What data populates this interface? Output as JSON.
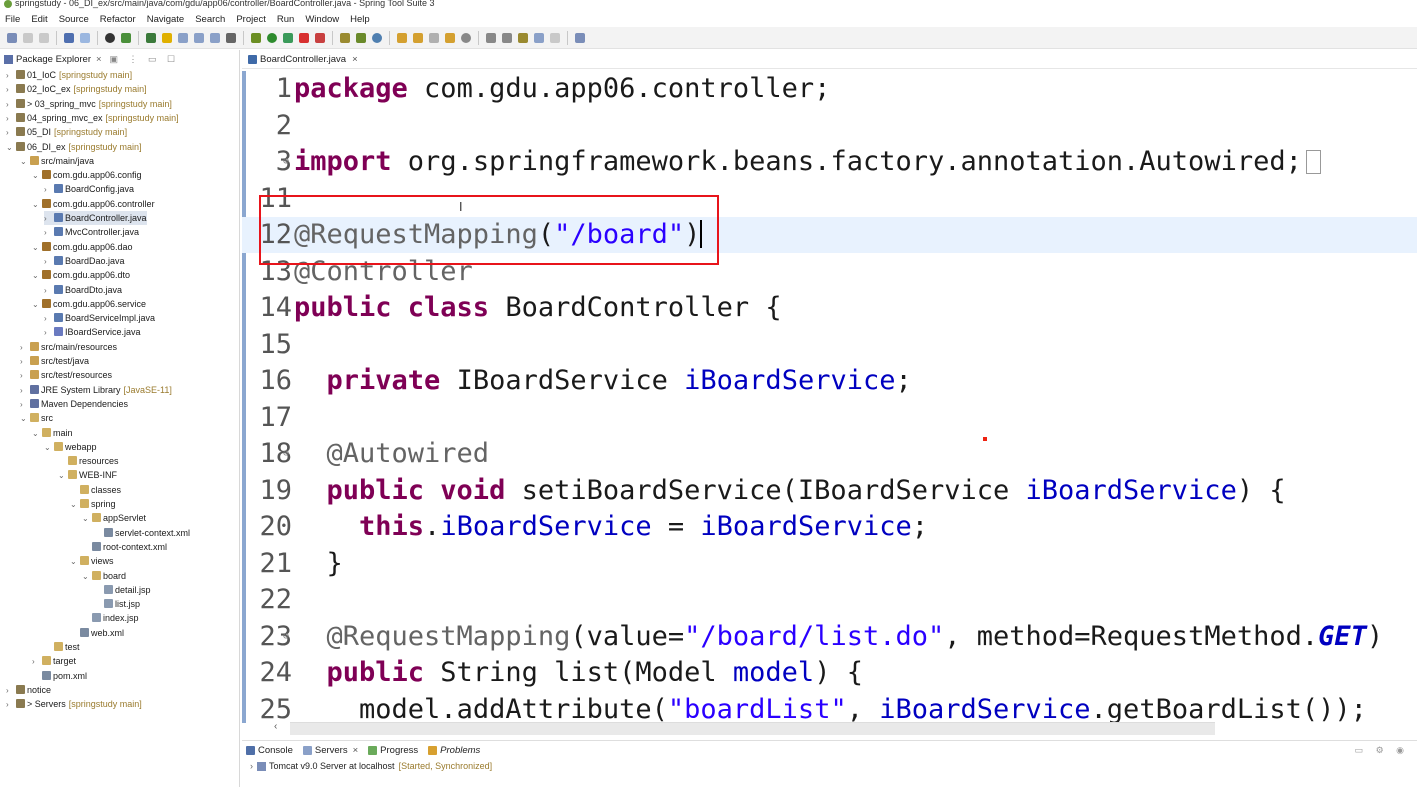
{
  "window": {
    "title": "springstudy - 06_DI_ex/src/main/java/com/gdu/app06/controller/BoardController.java - Spring Tool Suite 3"
  },
  "menu": [
    "File",
    "Edit",
    "Source",
    "Refactor",
    "Navigate",
    "Search",
    "Project",
    "Run",
    "Window",
    "Help"
  ],
  "explorer": {
    "tab_label": "Package Explorer",
    "items": [
      {
        "label": "01_IoC",
        "deco": "[springstudy main]"
      },
      {
        "label": "02_IoC_ex",
        "deco": "[springstudy main]"
      },
      {
        "label": "> 03_spring_mvc",
        "deco": "[springstudy main]"
      },
      {
        "label": "04_spring_mvc_ex",
        "deco": "[springstudy main]"
      },
      {
        "label": "05_DI",
        "deco": "[springstudy main]"
      },
      {
        "label": "06_DI_ex",
        "deco": "[springstudy main]"
      },
      {
        "label": "src/main/java",
        "deco": ""
      },
      {
        "label": "com.gdu.app06.config",
        "deco": ""
      },
      {
        "label": "BoardConfig.java",
        "deco": ""
      },
      {
        "label": "com.gdu.app06.controller",
        "deco": ""
      },
      {
        "label": "BoardController.java",
        "deco": ""
      },
      {
        "label": "MvcController.java",
        "deco": ""
      },
      {
        "label": "com.gdu.app06.dao",
        "deco": ""
      },
      {
        "label": "BoardDao.java",
        "deco": ""
      },
      {
        "label": "com.gdu.app06.dto",
        "deco": ""
      },
      {
        "label": "BoardDto.java",
        "deco": ""
      },
      {
        "label": "com.gdu.app06.service",
        "deco": ""
      },
      {
        "label": "BoardServiceImpl.java",
        "deco": ""
      },
      {
        "label": "IBoardService.java",
        "deco": ""
      },
      {
        "label": "src/main/resources",
        "deco": ""
      },
      {
        "label": "src/test/java",
        "deco": ""
      },
      {
        "label": "src/test/resources",
        "deco": ""
      },
      {
        "label": "JRE System Library",
        "deco": "[JavaSE-11]"
      },
      {
        "label": "Maven Dependencies",
        "deco": ""
      },
      {
        "label": "src",
        "deco": ""
      },
      {
        "label": "main",
        "deco": ""
      },
      {
        "label": "webapp",
        "deco": ""
      },
      {
        "label": "resources",
        "deco": ""
      },
      {
        "label": "WEB-INF",
        "deco": ""
      },
      {
        "label": "classes",
        "deco": ""
      },
      {
        "label": "spring",
        "deco": ""
      },
      {
        "label": "appServlet",
        "deco": ""
      },
      {
        "label": "servlet-context.xml",
        "deco": ""
      },
      {
        "label": "root-context.xml",
        "deco": ""
      },
      {
        "label": "views",
        "deco": ""
      },
      {
        "label": "board",
        "deco": ""
      },
      {
        "label": "detail.jsp",
        "deco": ""
      },
      {
        "label": "list.jsp",
        "deco": ""
      },
      {
        "label": "index.jsp",
        "deco": ""
      },
      {
        "label": "web.xml",
        "deco": ""
      },
      {
        "label": "test",
        "deco": ""
      },
      {
        "label": "target",
        "deco": ""
      },
      {
        "label": "pom.xml",
        "deco": ""
      },
      {
        "label": "notice",
        "deco": ""
      },
      {
        "label": "> Servers",
        "deco": "[springstudy main]"
      }
    ]
  },
  "editor": {
    "tab_label": "BoardController.java",
    "lines": [
      {
        "n": "1",
        "t1": "package com.gdu.app06.controller;"
      },
      {
        "n": "2"
      },
      {
        "n": "3",
        "t1": "import",
        "t2": " org.springframework.beans.factory.annotation.Autowired;"
      },
      {
        "n": "11"
      },
      {
        "n": "12",
        "t1": "@RequestMapping",
        "t2": "(",
        "t3": "\"/board\"",
        "t4": ")"
      },
      {
        "n": "13",
        "t1": "@Controller"
      },
      {
        "n": "14",
        "t1": "public class",
        "t2": " BoardController {"
      },
      {
        "n": "15"
      },
      {
        "n": "16",
        "t1": "  private",
        "t2": " IBoardService ",
        "t3": "iBoardService",
        "t4": ";"
      },
      {
        "n": "17"
      },
      {
        "n": "18",
        "t1": "  @Autowired"
      },
      {
        "n": "19",
        "t1": "  public void",
        "t2": " setiBoardService(IBoardService ",
        "t3": "iBoardService",
        "t4": ") {"
      },
      {
        "n": "20",
        "t1": "    this",
        "t2": ".",
        "t3": "iBoardService",
        "t4": " = ",
        "t5": "iBoardService",
        "t6": ";"
      },
      {
        "n": "21",
        "t1": "  }"
      },
      {
        "n": "22"
      },
      {
        "n": "23",
        "t1": "  @RequestMapping",
        "t2": "(value=",
        "t3": "\"/board/list.do\"",
        "t4": ", method=RequestMethod.",
        "t5": "GET",
        "t6": ")"
      },
      {
        "n": "24",
        "t1": "  public",
        "t2": " String list(Model ",
        "t3": "model",
        "t4": ") {"
      },
      {
        "n": "25",
        "t1": "    model",
        "t2": ".addAttribute(",
        "t3": "\"boardList\"",
        "t4": ", ",
        "t5": "iBoardService",
        "t6": ".getBoardList());"
      }
    ]
  },
  "console": {
    "tabs": [
      "Console",
      "Servers",
      "Progress",
      "Problems"
    ],
    "server_name": "Tomcat v9.0 Server at localhost",
    "server_status": "[Started, Synchronized]"
  },
  "colors": {
    "highlight_box": "#e8141b",
    "keyword": "#7f0055",
    "string": "#2a00ff",
    "field": "#0000c0",
    "annotation": "#646464",
    "current_line": "#e8f2fe"
  }
}
